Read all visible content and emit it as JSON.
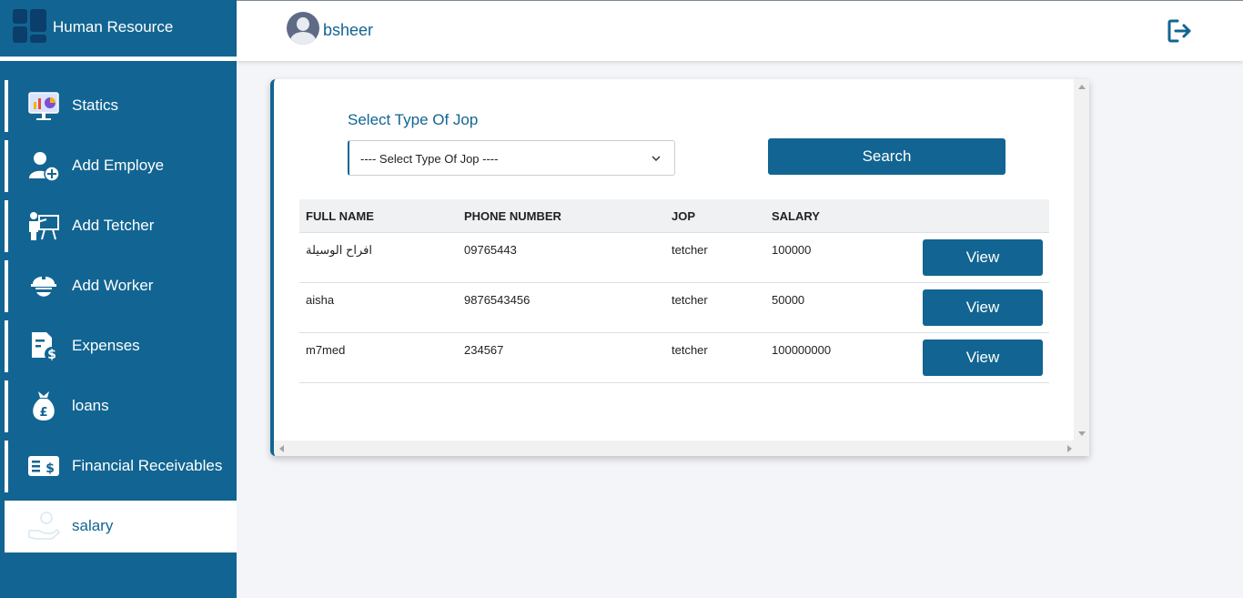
{
  "app": {
    "title": "Human Resource"
  },
  "user": {
    "name": "bsheer"
  },
  "header": {
    "logout_icon": "sign-out-icon"
  },
  "colors": {
    "primary": "#126592",
    "background": "#f4f5f8",
    "sidebar_active": "#ffffff"
  },
  "sidebar": {
    "items": [
      {
        "label": "Statics",
        "icon": "presentation-chart-icon",
        "active": false
      },
      {
        "label": "Add Employe",
        "icon": "add-user-icon",
        "active": false
      },
      {
        "label": "Add Tetcher",
        "icon": "teacher-icon",
        "active": false
      },
      {
        "label": "Add Worker",
        "icon": "hard-hat-worker-icon",
        "active": false
      },
      {
        "label": "Expenses",
        "icon": "expense-receipt-icon",
        "active": false
      },
      {
        "label": "loans",
        "icon": "money-bag-icon",
        "active": false
      },
      {
        "label": "Financial Receivables",
        "icon": "money-check-icon",
        "active": false
      },
      {
        "label": "salary",
        "icon": "hand-coin-icon",
        "active": true
      }
    ]
  },
  "filter": {
    "label": "Select Type Of Jop",
    "select_value": "---- Select Type Of Jop ----",
    "search_label": "Search"
  },
  "table": {
    "columns": [
      "FULL NAME",
      "PHONE NUMBER",
      "JOP",
      "SALARY"
    ],
    "rows": [
      {
        "full_name": "افراح الوسيلة",
        "phone": "09765443",
        "job": "tetcher",
        "salary": "100000",
        "action": "View"
      },
      {
        "full_name": "aisha",
        "phone": "9876543456",
        "job": "tetcher",
        "salary": "50000",
        "action": "View"
      },
      {
        "full_name": "m7med",
        "phone": "234567",
        "job": "tetcher",
        "salary": "100000000",
        "action": "View"
      }
    ]
  }
}
